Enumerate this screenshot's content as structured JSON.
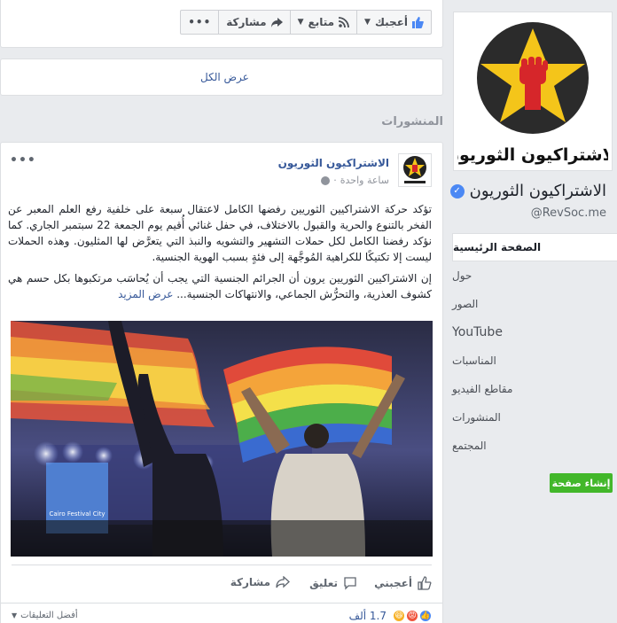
{
  "header": {
    "like_label": "أعجبك",
    "follow_label": "متابع",
    "share_label": "مشاركة",
    "more_label": "•••"
  },
  "see_all_label": "عرض الكل",
  "posts_section_title": "المنشورات",
  "post": {
    "more_label": "•••",
    "page_name": "الاشتراكيون الثوريون",
    "time": "ساعة واحدة",
    "time_sep": "·",
    "paragraph1": "تؤكد حركة الاشتراكيين الثوريين رفضها الكامل لاعتقال سبعة على خلفية رفع العلم المعبر عن الفخر بالتنوع والحرية والقبول بالاختلاف، في حفل غنائي أُقيم يوم الجمعة 22 سبتمبر الجاري. كما نؤكد رفضنا الكامل لكل حملات التشهير والتشويه والنبذ التي يتعرَّض لها المثليون. وهذه الحملات ليست إلا تكتيكًا للكراهية المُوجَّهة إلى فئةٍ بسبب الهوية الجنسية.",
    "paragraph2": "إن الاشتراكيين الثوريين يرون أن الجرائم الجنسية التي يجب أن يُحاسَب مرتكبوها بكل حسم هي كشوف العذرية، والتحرُّش الجماعي، والانتهاكات الجنسية...",
    "see_more": "عرض المزيد",
    "photo_sign_text": "Cairo Festival City",
    "like_action": "أعجبني",
    "comment_action": "تعليق",
    "share_action": "مشاركة",
    "reactions_count": "1.7 ألف",
    "best_comments": "أفضل التعليقات"
  },
  "sidebar": {
    "logo_text": "الاشتراكيون الثوريون",
    "page_name": "الاشتراكيون الثوريون",
    "handle": "@RevSoc.me",
    "nav": [
      {
        "label": "الصفحة الرئيسية"
      },
      {
        "label": "حول"
      },
      {
        "label": "الصور"
      },
      {
        "label": "YouTube"
      },
      {
        "label": "المناسبات"
      },
      {
        "label": "مقاطع الفيديو"
      },
      {
        "label": "المنشورات"
      },
      {
        "label": "المجتمع"
      }
    ],
    "create_page": "إنشاء صفحة"
  },
  "colors": {
    "fb_blue": "#365899",
    "brand_red": "#d6262a",
    "brand_yellow": "#f4c51a",
    "create_green": "#42b72a"
  }
}
